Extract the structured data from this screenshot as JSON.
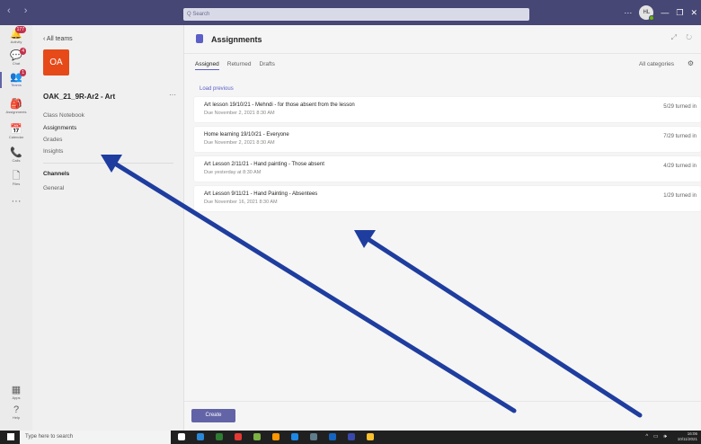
{
  "topbar": {
    "back_fwd": "‹ ›",
    "search_placeholder": "Q Search",
    "more": "···",
    "avatar_initials": "HL",
    "minimize": "—",
    "maximize": "❐",
    "close": "✕"
  },
  "rail": {
    "items": [
      {
        "label": "Activity",
        "icon": "bell-icon",
        "glyph": "🔔",
        "badge": "177"
      },
      {
        "label": "Chat",
        "icon": "chat-icon",
        "glyph": "💬",
        "badge": "4"
      },
      {
        "label": "Teams",
        "icon": "teams-icon",
        "glyph": "👥",
        "badge": "1"
      },
      {
        "label": "Assignments",
        "icon": "assignments-icon",
        "glyph": "🎒",
        "badge": ""
      },
      {
        "label": "Calendar",
        "icon": "calendar-icon",
        "glyph": "📅",
        "badge": ""
      },
      {
        "label": "Calls",
        "icon": "phone-icon",
        "glyph": "📞",
        "badge": ""
      },
      {
        "label": "Files",
        "icon": "file-icon",
        "glyph": "🗋",
        "badge": ""
      },
      {
        "label": "",
        "icon": "more-icon",
        "glyph": "···",
        "badge": ""
      }
    ],
    "bottom": [
      {
        "label": "Apps",
        "icon": "apps-icon",
        "glyph": "▦"
      },
      {
        "label": "Help",
        "icon": "help-icon",
        "glyph": "?"
      }
    ]
  },
  "sidepanel": {
    "all_teams": "‹  All teams",
    "team_initials": "OA",
    "team_name": "OAK_21_9R-Ar2 - Art",
    "team_more": "···",
    "links": [
      "Class Notebook",
      "Assignments",
      "Grades",
      "Insights"
    ],
    "channels_heading": "Channels",
    "channels": [
      "General"
    ]
  },
  "main": {
    "title": "Assignments",
    "header_right": "⤢ ↻",
    "tabs": [
      "Assigned",
      "Returned",
      "Drafts"
    ],
    "category_filter": "All categories",
    "settings_glyph": "⚙",
    "load_previous": "Load previous",
    "assignments": [
      {
        "title": "Art lesson 19/10/21 - Mehndi - for those absent from the lesson",
        "due": "Due November 2, 2021 8:30 AM",
        "status": "5/29 turned in"
      },
      {
        "title": "Home learning 19/10/21 - Everyone",
        "due": "Due November 2, 2021 8:30 AM",
        "status": "7/29 turned in"
      },
      {
        "title": "Art Lesson 2/11/21 - Hand painting - Those absent",
        "due": "Due yesterday at 8:30 AM",
        "status": "4/29 turned in"
      },
      {
        "title": "Art Lesson 9/11/21 - Hand Painting - Absentees",
        "due": "Due November 16, 2021 8:30 AM",
        "status": "1/29 turned in"
      }
    ],
    "create_label": "Create"
  },
  "taskbar": {
    "search_placeholder": "Type here to search",
    "tray": "^ ▭ 🕪",
    "time": "16:06",
    "date": "10/11/2021",
    "app_colors": [
      "#ffffff",
      "#2b88d8",
      "#2e7d32",
      "#e53935",
      "#7cb342",
      "#ff9800",
      "#1e88e5",
      "#607d8b",
      "#1565c0",
      "#3949ab",
      "#fbc02d"
    ]
  },
  "colors": {
    "teams_purple": "#464775",
    "accent": "#6264a7",
    "team_tile": "#e64a19",
    "arrow": "#2b4db0"
  }
}
